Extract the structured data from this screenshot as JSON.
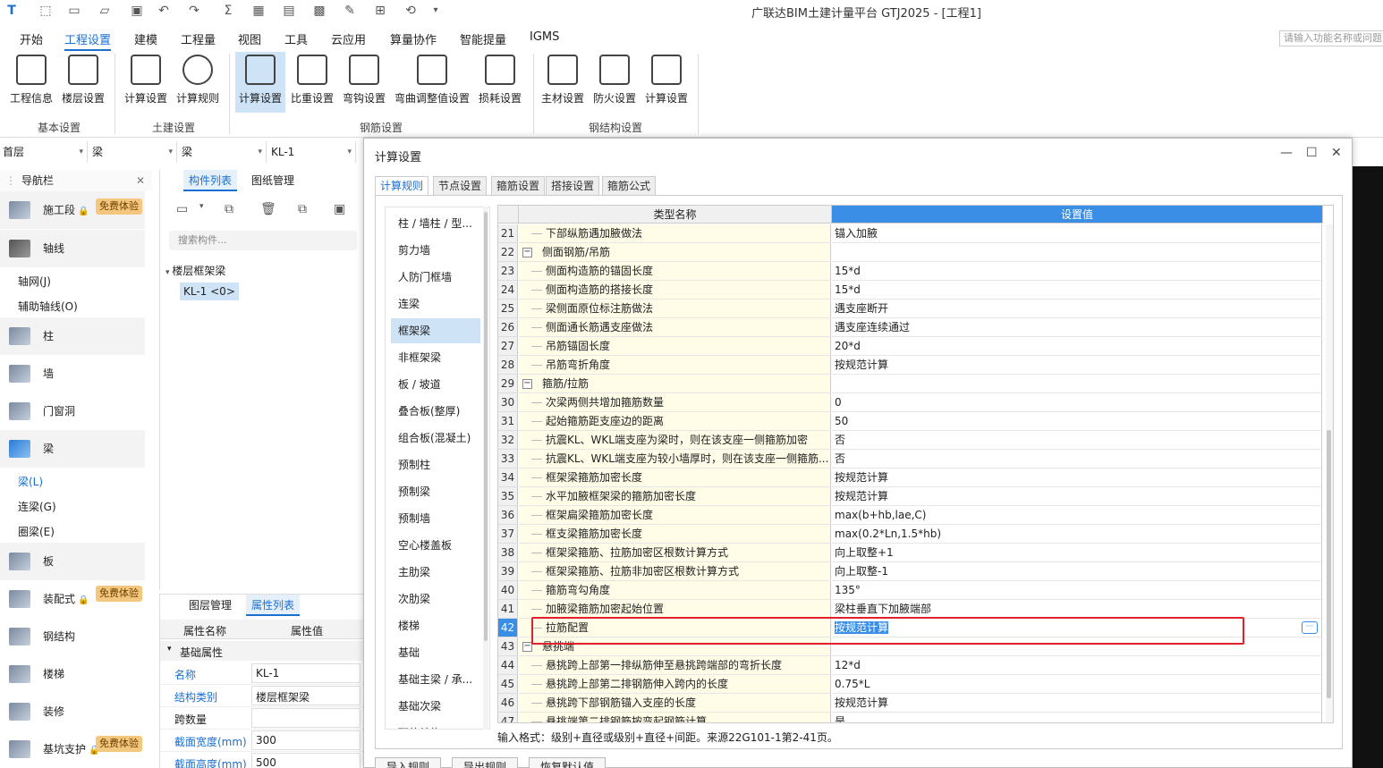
{
  "app": {
    "title": "广联达BIM土建计量平台 GTJ2025 - [工程1]",
    "search_placeholder": "请输入功能名称或问题"
  },
  "menu": [
    "开始",
    "工程设置",
    "建模",
    "工程量",
    "视图",
    "工具",
    "云应用",
    "算量协作",
    "智能提量",
    "IGMS"
  ],
  "ribbon": {
    "buttons": [
      "工程信息",
      "楼层设置",
      "计算设置",
      "计算规则",
      "计算设置",
      "比重设置",
      "弯钩设置",
      "弯曲调整值设置",
      "损耗设置",
      "主材设置",
      "防火设置",
      "计算设置"
    ],
    "groups": [
      "基本设置",
      "土建设置",
      "钢筋设置",
      "钢结构设置"
    ]
  },
  "selectors": [
    "首层",
    "梁",
    "梁",
    "KL-1"
  ],
  "nav": {
    "title": "导航栏",
    "items": [
      "施工段",
      "轴线",
      "柱",
      "墙",
      "门窗洞",
      "梁",
      "板",
      "装配式",
      "钢结构",
      "楼梯",
      "装修",
      "基坑支护"
    ],
    "badge": "免费体验",
    "sub_axis": [
      "轴网(J)",
      "辅助轴线(O)"
    ],
    "sub_beam": [
      "梁(L)",
      "连梁(G)",
      "圈梁(E)"
    ]
  },
  "components": {
    "tabs": [
      "构件列表",
      "图纸管理"
    ],
    "search_placeholder": "搜索构件...",
    "group": "楼层框架梁",
    "item": "KL-1 <0>"
  },
  "props": {
    "tabs": [
      "图层管理",
      "属性列表"
    ],
    "col_name": "属性名称",
    "col_val": "属性值",
    "group": "基础属性",
    "rows": [
      [
        "名称",
        "KL-1"
      ],
      [
        "结构类别",
        "楼层框架梁"
      ],
      [
        "跨数量",
        ""
      ],
      [
        "截面宽度(mm)",
        "300"
      ],
      [
        "截面高度(mm)",
        "500"
      ]
    ]
  },
  "dialog": {
    "title": "计算设置",
    "tabs": [
      "计算规则",
      "节点设置",
      "箍筋设置",
      "搭接设置",
      "箍筋公式"
    ],
    "categories": [
      "柱 / 墙柱 / 型...",
      "剪力墙",
      "人防门框墙",
      "连梁",
      "框架梁",
      "非框架梁",
      "板 / 坡道",
      "叠合板(整厚)",
      "组合板(混凝土)",
      "预制柱",
      "预制梁",
      "预制墙",
      "空心楼盖板",
      "主肋梁",
      "次肋梁",
      "楼梯",
      "基础",
      "基础主梁 / 承...",
      "基础次梁",
      "砌体结构"
    ],
    "col_type": "类型名称",
    "col_value": "设置值",
    "rows": [
      {
        "n": "21",
        "name": "下部纵筋遇加腋做法",
        "val": "锚入加腋"
      },
      {
        "n": "22",
        "name": "侧面钢筋/吊筋",
        "val": "",
        "grp": true
      },
      {
        "n": "23",
        "name": "侧面构造筋的锚固长度",
        "val": "15*d"
      },
      {
        "n": "24",
        "name": "侧面构造筋的搭接长度",
        "val": "15*d"
      },
      {
        "n": "25",
        "name": "梁侧面原位标注筋做法",
        "val": "遇支座断开"
      },
      {
        "n": "26",
        "name": "侧面通长筋遇支座做法",
        "val": "遇支座连续通过"
      },
      {
        "n": "27",
        "name": "吊筋锚固长度",
        "val": "20*d"
      },
      {
        "n": "28",
        "name": "吊筋弯折角度",
        "val": "按规范计算"
      },
      {
        "n": "29",
        "name": "箍筋/拉筋",
        "val": "",
        "grp": true
      },
      {
        "n": "30",
        "name": "次梁两侧共增加箍筋数量",
        "val": "0"
      },
      {
        "n": "31",
        "name": "起始箍筋距支座边的距离",
        "val": "50"
      },
      {
        "n": "32",
        "name": "抗震KL、WKL端支座为梁时，则在该支座一侧箍筋加密",
        "val": "否"
      },
      {
        "n": "33",
        "name": "抗震KL、WKL端支座为较小墙厚时，则在该支座一侧箍筋...",
        "val": "否"
      },
      {
        "n": "34",
        "name": "框架梁箍筋加密长度",
        "val": "按规范计算"
      },
      {
        "n": "35",
        "name": "水平加腋框架梁的箍筋加密长度",
        "val": "按规范计算"
      },
      {
        "n": "36",
        "name": "框架扁梁箍筋加密长度",
        "val": "max(b+hb,lae,C)"
      },
      {
        "n": "37",
        "name": "框支梁箍筋加密长度",
        "val": "max(0.2*Ln,1.5*hb)"
      },
      {
        "n": "38",
        "name": "框架梁箍筋、拉筋加密区根数计算方式",
        "val": "向上取整+1"
      },
      {
        "n": "39",
        "name": "框架梁箍筋、拉筋非加密区根数计算方式",
        "val": "向上取整-1"
      },
      {
        "n": "40",
        "name": "箍筋弯勾角度",
        "val": "135°"
      },
      {
        "n": "41",
        "name": "加腋梁箍筋加密起始位置",
        "val": "梁柱垂直下加腋端部"
      },
      {
        "n": "42",
        "name": "拉筋配置",
        "val": "按规范计算",
        "sel": true
      },
      {
        "n": "43",
        "name": "悬挑端",
        "val": "",
        "grp": true
      },
      {
        "n": "44",
        "name": "悬挑跨上部第一排纵筋伸至悬挑跨端部的弯折长度",
        "val": "12*d"
      },
      {
        "n": "45",
        "name": "悬挑跨上部第二排钢筋伸入跨内的长度",
        "val": "0.75*L"
      },
      {
        "n": "46",
        "name": "悬挑跨下部钢筋锚入支座的长度",
        "val": "按规范计算"
      },
      {
        "n": "47",
        "name": "悬挑端第二排钢筋按弯起钢筋计算",
        "val": "是"
      }
    ],
    "hint": "输入格式：级别+直径或级别+直径+间距。来源22G101-1第2-41页。",
    "buttons": [
      "导入规则",
      "导出规则",
      "恢复默认值"
    ]
  },
  "colors": {
    "accent": "#1a6fd0",
    "highlight": "#e0202a",
    "selection": "#cfe3f7",
    "badge": "#f5c77e"
  }
}
